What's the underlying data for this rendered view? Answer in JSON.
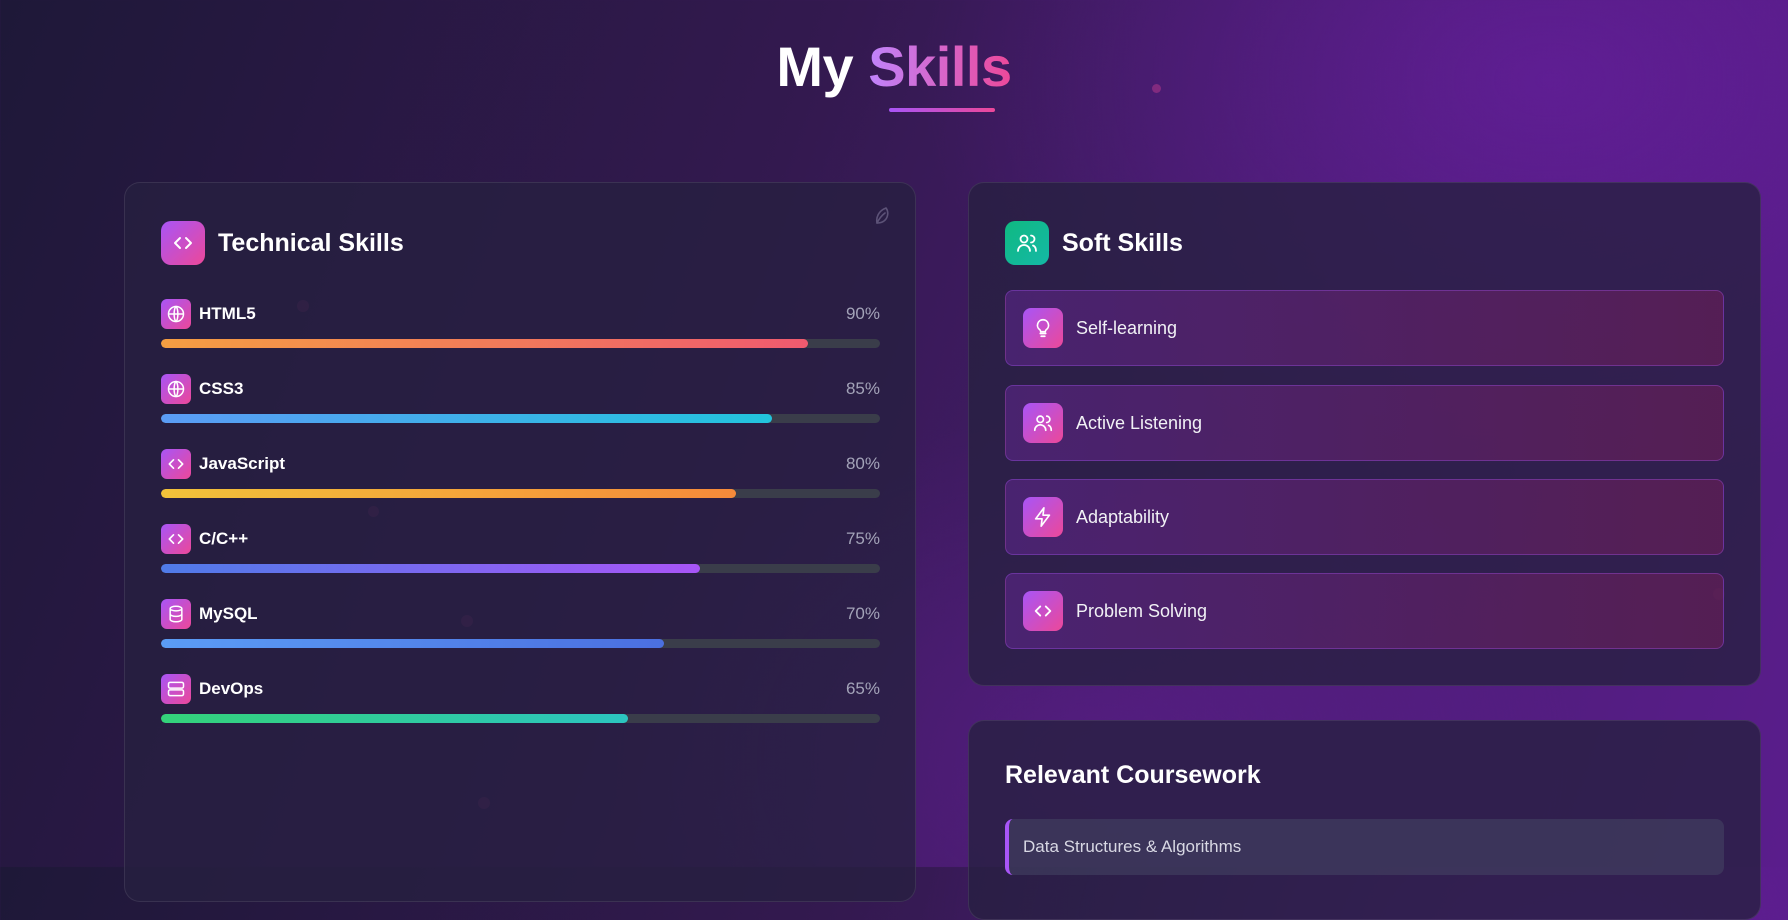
{
  "page": {
    "title_part1": "My",
    "title_part2": "Skills"
  },
  "technical": {
    "title": "Technical Skills",
    "icon": "code-icon",
    "skills": [
      {
        "name": "HTML5",
        "percent_label": "90%",
        "level": 0.9,
        "icon": "globe-icon",
        "bar_from": "#f59e42",
        "bar_to": "#ef5a6f"
      },
      {
        "name": "CSS3",
        "percent_label": "85%",
        "level": 0.85,
        "icon": "globe-icon",
        "bar_from": "#5b9cf5",
        "bar_to": "#22c4dd"
      },
      {
        "name": "JavaScript",
        "percent_label": "80%",
        "level": 0.8,
        "icon": "code-icon",
        "bar_from": "#f2c23a",
        "bar_to": "#f58a3a"
      },
      {
        "name": "C/C++",
        "percent_label": "75%",
        "level": 0.75,
        "icon": "code-icon",
        "bar_from": "#4f7be8",
        "bar_to": "#a855f7"
      },
      {
        "name": "MySQL",
        "percent_label": "70%",
        "level": 0.7,
        "icon": "database-icon",
        "bar_from": "#5b9cf5",
        "bar_to": "#4b6fe0"
      },
      {
        "name": "DevOps",
        "percent_label": "65%",
        "level": 0.65,
        "icon": "server-icon",
        "bar_from": "#34d27a",
        "bar_to": "#2cc5c0"
      }
    ]
  },
  "soft": {
    "title": "Soft Skills",
    "icon": "users-icon",
    "items": [
      {
        "label": "Self-learning",
        "icon": "lightbulb-icon"
      },
      {
        "label": "Active Listening",
        "icon": "users-icon"
      },
      {
        "label": "Adaptability",
        "icon": "lightning-icon"
      },
      {
        "label": "Problem Solving",
        "icon": "code-icon"
      }
    ]
  },
  "coursework": {
    "title": "Relevant Coursework",
    "items": [
      "Data Structures & Algorithms"
    ]
  },
  "colors": {
    "accent_purple": "#a855f7",
    "accent_pink": "#ec4899",
    "accent_green": "#10b981"
  }
}
